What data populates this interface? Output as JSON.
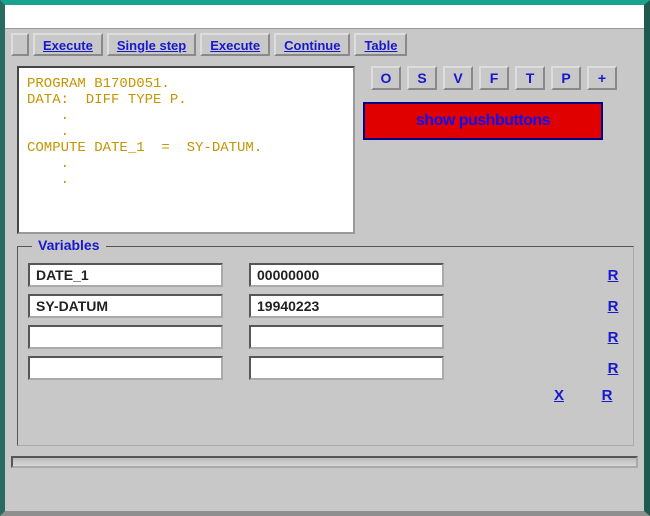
{
  "toolbar": {
    "execute1": "Execute",
    "single_step": "Single step",
    "execute2": "Execute",
    "continue": "Continue",
    "table": "Table"
  },
  "letter_buttons": [
    "O",
    "S",
    "V",
    "F",
    "T",
    "P",
    "+"
  ],
  "red_panel": {
    "text": "show pushbuttons"
  },
  "code": "PROGRAM B170D051.\nDATA:  DIFF TYPE P.\n    .\n    .\nCOMPUTE DATE_1  =  SY-DATUM.\n    .\n    .",
  "vars": {
    "legend": "Variables",
    "rows": [
      {
        "name": "DATE_1",
        "value": "00000000"
      },
      {
        "name": "SY-DATUM",
        "value": "19940223"
      },
      {
        "name": "",
        "value": ""
      },
      {
        "name": "",
        "value": ""
      }
    ],
    "r_label": "R",
    "x_label": "X"
  }
}
